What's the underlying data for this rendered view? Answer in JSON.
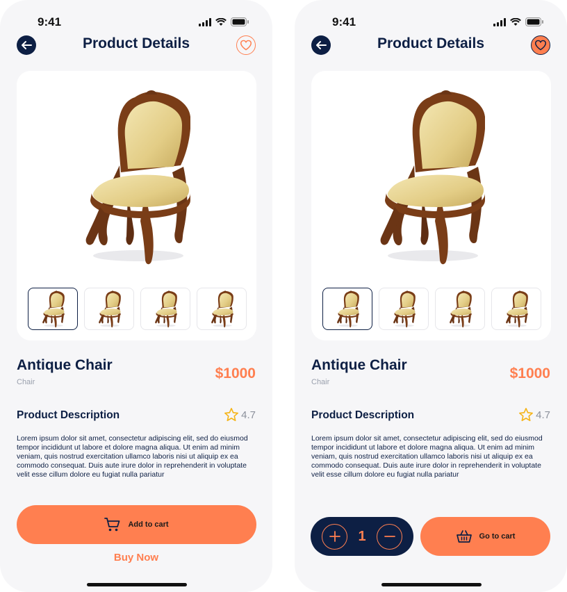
{
  "colors": {
    "navy": "#0d1f44",
    "accent": "#ff7f50",
    "background": "#f6f6f8",
    "muted": "#9aa0ad"
  },
  "screens": [
    {
      "status": {
        "time": "9:41"
      },
      "header": {
        "title": "Product Details",
        "back_icon": "arrow-left-icon",
        "favorite_icon": "heart-outline-icon"
      },
      "product": {
        "name": "Antique Chair",
        "category": "Chair",
        "price": "$1000",
        "thumbnail_count": 4
      },
      "description": {
        "heading": "Product Description",
        "rating": "4.7",
        "text": "Lorem ipsum dolor sit amet, consectetur adipiscing elit, sed do eiusmod tempor incididunt ut labore et dolore magna aliqua. Ut enim ad minim veniam, quis nostrud exercitation ullamco laboris nisi ut aliquip ex ea commodo consequat. Duis aute irure dolor in reprehenderit in voluptate velit esse cillum dolore eu fugiat nulla pariatur"
      },
      "actions": {
        "add_to_cart": "Add to cart",
        "buy_now": "Buy Now"
      }
    },
    {
      "status": {
        "time": "9:41"
      },
      "header": {
        "title": "Product Details",
        "back_icon": "arrow-left-icon",
        "favorite_icon": "heart-filled-icon"
      },
      "product": {
        "name": "Antique Chair",
        "category": "Chair",
        "price": "$1000",
        "thumbnail_count": 4
      },
      "description": {
        "heading": "Product Description",
        "rating": "4.7",
        "text": "Lorem ipsum dolor sit amet, consectetur adipiscing elit, sed do eiusmod tempor incididunt ut labore et dolore magna aliqua. Ut enim ad minim veniam, quis nostrud exercitation ullamco laboris nisi ut aliquip ex ea commodo consequat. Duis aute irure dolor in reprehenderit in voluptate velit esse cillum dolore eu fugiat nulla pariatur"
      },
      "actions": {
        "quantity": "1",
        "go_to_cart": "Go to cart"
      }
    }
  ]
}
